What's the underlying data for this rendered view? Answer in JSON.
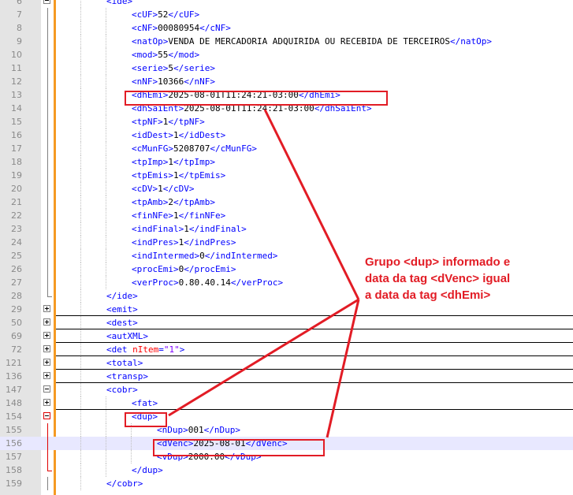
{
  "editor": {
    "lines": [
      {
        "num": "6",
        "indent": 2,
        "parts": [
          [
            "tag",
            "<ide>"
          ]
        ],
        "fold": "open"
      },
      {
        "num": "7",
        "indent": 3,
        "parts": [
          [
            "tag",
            "<cUF>"
          ],
          [
            "text",
            "52"
          ],
          [
            "tag",
            "</cUF>"
          ]
        ]
      },
      {
        "num": "8",
        "indent": 3,
        "parts": [
          [
            "tag",
            "<cNF>"
          ],
          [
            "text",
            "00080954"
          ],
          [
            "tag",
            "</cNF>"
          ]
        ]
      },
      {
        "num": "9",
        "indent": 3,
        "parts": [
          [
            "tag",
            "<natOp>"
          ],
          [
            "text",
            "VENDA DE MERCADORIA ADQUIRIDA OU RECEBIDA DE TERCEIROS"
          ],
          [
            "tag",
            "</natOp>"
          ]
        ]
      },
      {
        "num": "10",
        "indent": 3,
        "parts": [
          [
            "tag",
            "<mod>"
          ],
          [
            "text",
            "55"
          ],
          [
            "tag",
            "</mod>"
          ]
        ]
      },
      {
        "num": "11",
        "indent": 3,
        "parts": [
          [
            "tag",
            "<serie>"
          ],
          [
            "text",
            "5"
          ],
          [
            "tag",
            "</serie>"
          ]
        ]
      },
      {
        "num": "12",
        "indent": 3,
        "parts": [
          [
            "tag",
            "<nNF>"
          ],
          [
            "text",
            "10366"
          ],
          [
            "tag",
            "</nNF>"
          ]
        ]
      },
      {
        "num": "13",
        "indent": 3,
        "parts": [
          [
            "tag",
            "<dhEmi>"
          ],
          [
            "text",
            "2025-08-01T11:24:21-03:00"
          ],
          [
            "tag",
            "</dhEmi>"
          ]
        ]
      },
      {
        "num": "14",
        "indent": 3,
        "parts": [
          [
            "tag",
            "<dhSaiEnt>"
          ],
          [
            "text",
            "2025-08-01T11:24:21-03:00"
          ],
          [
            "tag",
            "</dhSaiEnt>"
          ]
        ]
      },
      {
        "num": "15",
        "indent": 3,
        "parts": [
          [
            "tag",
            "<tpNF>"
          ],
          [
            "text",
            "1"
          ],
          [
            "tag",
            "</tpNF>"
          ]
        ]
      },
      {
        "num": "16",
        "indent": 3,
        "parts": [
          [
            "tag",
            "<idDest>"
          ],
          [
            "text",
            "1"
          ],
          [
            "tag",
            "</idDest>"
          ]
        ]
      },
      {
        "num": "17",
        "indent": 3,
        "parts": [
          [
            "tag",
            "<cMunFG>"
          ],
          [
            "text",
            "5208707"
          ],
          [
            "tag",
            "</cMunFG>"
          ]
        ]
      },
      {
        "num": "18",
        "indent": 3,
        "parts": [
          [
            "tag",
            "<tpImp>"
          ],
          [
            "text",
            "1"
          ],
          [
            "tag",
            "</tpImp>"
          ]
        ]
      },
      {
        "num": "19",
        "indent": 3,
        "parts": [
          [
            "tag",
            "<tpEmis>"
          ],
          [
            "text",
            "1"
          ],
          [
            "tag",
            "</tpEmis>"
          ]
        ]
      },
      {
        "num": "20",
        "indent": 3,
        "parts": [
          [
            "tag",
            "<cDV>"
          ],
          [
            "text",
            "1"
          ],
          [
            "tag",
            "</cDV>"
          ]
        ]
      },
      {
        "num": "21",
        "indent": 3,
        "parts": [
          [
            "tag",
            "<tpAmb>"
          ],
          [
            "text",
            "2"
          ],
          [
            "tag",
            "</tpAmb>"
          ]
        ]
      },
      {
        "num": "22",
        "indent": 3,
        "parts": [
          [
            "tag",
            "<finNFe>"
          ],
          [
            "text",
            "1"
          ],
          [
            "tag",
            "</finNFe>"
          ]
        ]
      },
      {
        "num": "23",
        "indent": 3,
        "parts": [
          [
            "tag",
            "<indFinal>"
          ],
          [
            "text",
            "1"
          ],
          [
            "tag",
            "</indFinal>"
          ]
        ]
      },
      {
        "num": "24",
        "indent": 3,
        "parts": [
          [
            "tag",
            "<indPres>"
          ],
          [
            "text",
            "1"
          ],
          [
            "tag",
            "</indPres>"
          ]
        ]
      },
      {
        "num": "25",
        "indent": 3,
        "parts": [
          [
            "tag",
            "<indIntermed>"
          ],
          [
            "text",
            "0"
          ],
          [
            "tag",
            "</indIntermed>"
          ]
        ]
      },
      {
        "num": "26",
        "indent": 3,
        "parts": [
          [
            "tag",
            "<procEmi>"
          ],
          [
            "text",
            "0"
          ],
          [
            "tag",
            "</procEmi>"
          ]
        ]
      },
      {
        "num": "27",
        "indent": 3,
        "parts": [
          [
            "tag",
            "<verProc>"
          ],
          [
            "text",
            "0.80.40.14"
          ],
          [
            "tag",
            "</verProc>"
          ]
        ]
      },
      {
        "num": "28",
        "indent": 2,
        "parts": [
          [
            "tag",
            "</ide>"
          ]
        ],
        "fold": "end"
      },
      {
        "num": "29",
        "indent": 2,
        "parts": [
          [
            "tag",
            "<emit>"
          ]
        ],
        "fold": "collapsed"
      },
      {
        "num": "50",
        "indent": 2,
        "parts": [
          [
            "tag",
            "<dest>"
          ]
        ],
        "fold": "collapsed"
      },
      {
        "num": "69",
        "indent": 2,
        "parts": [
          [
            "tag",
            "<autXML>"
          ]
        ],
        "fold": "collapsed"
      },
      {
        "num": "72",
        "indent": 2,
        "parts": [
          [
            "tag",
            "<det "
          ],
          [
            "attr",
            "nItem"
          ],
          [
            "tag",
            "="
          ],
          [
            "val",
            "\"1\""
          ],
          [
            "tag",
            ">"
          ]
        ],
        "fold": "collapsed"
      },
      {
        "num": "121",
        "indent": 2,
        "parts": [
          [
            "tag",
            "<total>"
          ]
        ],
        "fold": "collapsed"
      },
      {
        "num": "136",
        "indent": 2,
        "parts": [
          [
            "tag",
            "<transp>"
          ]
        ],
        "fold": "collapsed"
      },
      {
        "num": "147",
        "indent": 2,
        "parts": [
          [
            "tag",
            "<cobr>"
          ]
        ],
        "fold": "open"
      },
      {
        "num": "148",
        "indent": 3,
        "parts": [
          [
            "tag",
            "<fat>"
          ]
        ],
        "fold": "collapsed"
      },
      {
        "num": "154",
        "indent": 3,
        "parts": [
          [
            "tag",
            "<dup>"
          ]
        ],
        "fold": "open-red"
      },
      {
        "num": "155",
        "indent": 4,
        "parts": [
          [
            "tag",
            "<nDup>"
          ],
          [
            "text",
            "001"
          ],
          [
            "tag",
            "</nDup>"
          ]
        ]
      },
      {
        "num": "156",
        "indent": 4,
        "parts": [
          [
            "tag",
            "<dVenc>"
          ],
          [
            "text",
            "2025-08-01"
          ],
          [
            "tag",
            "</dVenc>"
          ]
        ],
        "current": true
      },
      {
        "num": "157",
        "indent": 4,
        "parts": [
          [
            "tag",
            "<vDup>"
          ],
          [
            "text",
            "2000.00"
          ],
          [
            "tag",
            "</vDup>"
          ]
        ]
      },
      {
        "num": "158",
        "indent": 3,
        "parts": [
          [
            "tag",
            "</dup>"
          ]
        ],
        "fold": "end-red"
      },
      {
        "num": "159",
        "indent": 2,
        "parts": [
          [
            "tag",
            "</cobr>"
          ]
        ]
      }
    ]
  },
  "annotation": {
    "lines": [
      "Grupo <dup> informado e",
      "data da tag <dVenc> igual",
      "a data da tag <dhEmi>"
    ],
    "color": "#e21c25"
  },
  "colors": {
    "tag": "#0000ff",
    "text": "#000000",
    "attr": "#ff0000",
    "value": "#8000ff",
    "current_line": "#e8e8ff",
    "change_bar": "#f59a23"
  }
}
